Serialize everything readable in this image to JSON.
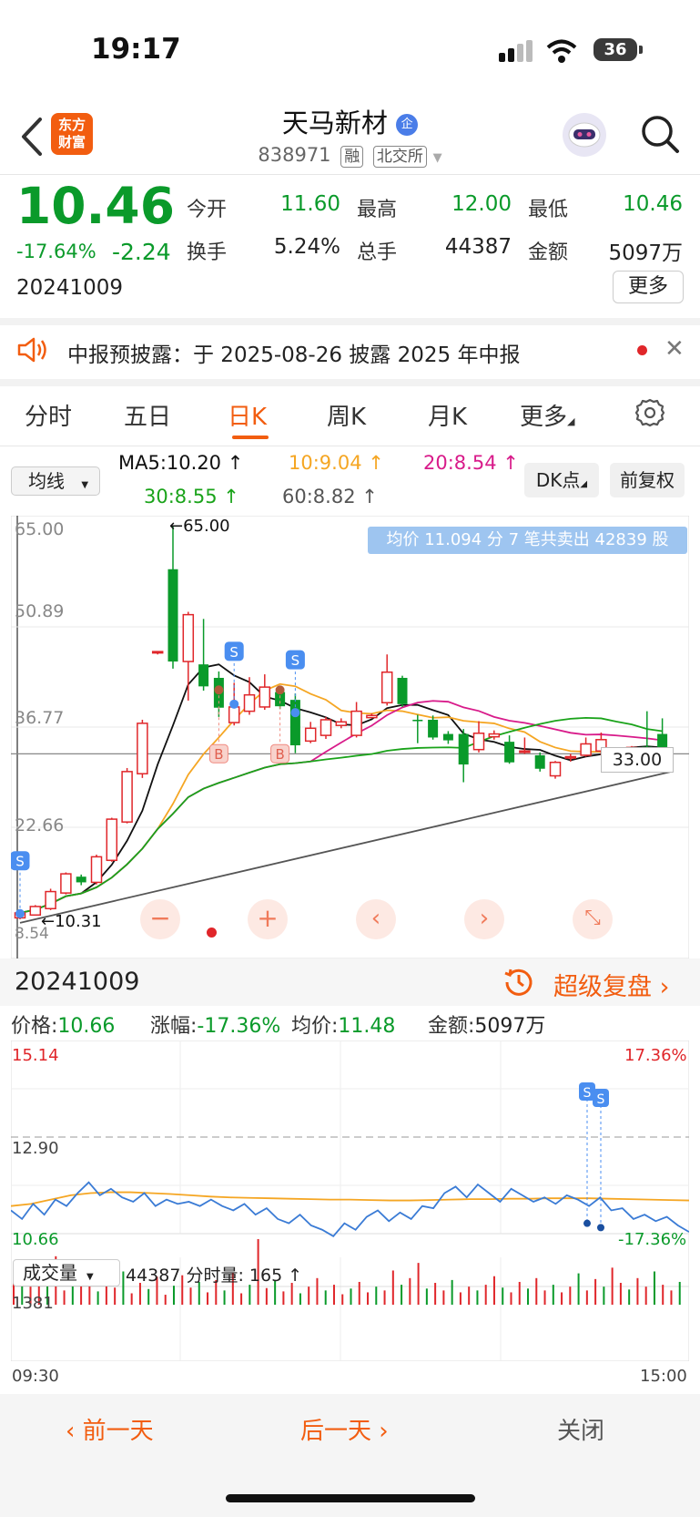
{
  "status": {
    "time": "19:17",
    "battery": "36"
  },
  "header": {
    "logo_line1": "东方",
    "logo_line2": "财富",
    "name": "天马新材",
    "badge": "企",
    "code": "838971",
    "tag1": "融",
    "tag2": "北交所"
  },
  "quote": {
    "price": "10.46",
    "pct": "-17.64%",
    "chg": "-2.24",
    "date": "20241009",
    "open_label": "今开",
    "open": "11.60",
    "high_label": "最高",
    "high": "12.00",
    "low_label": "最低",
    "low": "10.46",
    "turnover_label": "换手",
    "turnover": "5.24%",
    "volume_label": "总手",
    "volume": "44387",
    "amount_label": "金额",
    "amount": "5097万",
    "more": "更多"
  },
  "notice": {
    "text": "中报预披露：于 2025-08-26 披露 2025 年中报"
  },
  "tabs": [
    "分时",
    "五日",
    "日K",
    "周K",
    "月K",
    "更多"
  ],
  "ma": {
    "select": "均线",
    "ma5": "MA5:10.20 ↑",
    "ma10": "10:9.04 ↑",
    "ma20": "20:8.54 ↑",
    "ma30": "30:8.55 ↑",
    "ma60": "60:8.82 ↑",
    "dk": "DK点",
    "fq": "前复权",
    "colors": {
      "ma5": "#111111",
      "ma10": "#f5a623",
      "ma20": "#d81b8a",
      "ma30": "#1aa31a",
      "ma60": "#555555"
    }
  },
  "kchart": {
    "y_labels": [
      "65.00",
      "50.89",
      "36.77",
      "22.66",
      "8.54"
    ],
    "high_mark": "←65.00",
    "low_mark": "←10.31",
    "price_tag": "33.00",
    "banner": "均价 11.094 分 7 笔共卖出 42839 股",
    "buy": "B",
    "sell": "S"
  },
  "intraday": {
    "date": "20241009",
    "replay": "超级复盘",
    "price_label": "价格:",
    "price": "10.66",
    "chg_label": "涨幅:",
    "chg": "-17.36%",
    "avg_label": "均价:",
    "avg": "11.48",
    "amt_label": "金额:",
    "amt": "5097万",
    "y_top": "15.14",
    "y_mid": "12.90",
    "y_bot": "10.66",
    "pct_top": "17.36%",
    "pct_bot": "-17.36%",
    "vol_select": "成交量",
    "vol_info": "44387 分时量: 165 ↑",
    "vol_max": "1381",
    "t_start": "09:30",
    "t_end": "15:00"
  },
  "bottom": {
    "prev": "前一天",
    "next": "后一天",
    "close": "关闭"
  },
  "chart_data": {
    "type": "candlestick",
    "ylim": [
      8.54,
      65.0
    ],
    "candles": [
      [
        9.9,
        10.6,
        9.7,
        10.8
      ],
      [
        10.3,
        11.5,
        10.31,
        11.7
      ],
      [
        11.2,
        13.6,
        11.0,
        14.0
      ],
      [
        13.4,
        16.1,
        13.2,
        16.3
      ],
      [
        15.7,
        14.9,
        14.5,
        16.0
      ],
      [
        14.9,
        18.5,
        14.6,
        18.8
      ],
      [
        18.0,
        23.8,
        17.8,
        24.0
      ],
      [
        23.4,
        30.5,
        23.2,
        31.0
      ],
      [
        30.2,
        37.3,
        29.6,
        37.8
      ],
      [
        47.4,
        47.4,
        47.0,
        47.4
      ],
      [
        59.0,
        46.0,
        45.0,
        65.0
      ],
      [
        46.0,
        52.6,
        40.5,
        53.0
      ],
      [
        45.6,
        42.5,
        41.9,
        52.0
      ],
      [
        43.7,
        39.5,
        38.2,
        44.6
      ],
      [
        37.4,
        39.6,
        37.0,
        43.0
      ],
      [
        39.0,
        41.3,
        38.5,
        43.8
      ],
      [
        39.6,
        42.4,
        39.2,
        44.2
      ],
      [
        41.7,
        39.7,
        39.3,
        42.2
      ],
      [
        40.6,
        34.2,
        33.1,
        41.5
      ],
      [
        34.8,
        36.6,
        34.5,
        37.5
      ],
      [
        35.6,
        37.8,
        35.1,
        38.2
      ],
      [
        37.0,
        37.5,
        36.6,
        38.0
      ],
      [
        35.6,
        39.0,
        35.3,
        40.3
      ],
      [
        38.1,
        38.4,
        38.1,
        38.7
      ],
      [
        40.2,
        44.5,
        39.8,
        47.0
      ],
      [
        43.7,
        40.0,
        39.6,
        44.0
      ],
      [
        37.8,
        37.6,
        34.5,
        38.5
      ],
      [
        37.8,
        35.3,
        35.0,
        38.4
      ],
      [
        35.8,
        34.9,
        34.4,
        36.2
      ],
      [
        35.8,
        31.5,
        29.0,
        36.5
      ],
      [
        33.6,
        35.9,
        33.2,
        37.6
      ],
      [
        35.4,
        35.8,
        35.0,
        36.3
      ],
      [
        34.7,
        31.8,
        31.6,
        35.6
      ],
      [
        33.2,
        33.4,
        33.0,
        35.3
      ],
      [
        32.8,
        30.9,
        30.5,
        33.2
      ],
      [
        29.9,
        31.8,
        29.5,
        32.0
      ],
      [
        32.4,
        32.6,
        31.9,
        33.0
      ],
      [
        32.8,
        34.4,
        32.6,
        35.3
      ],
      [
        33.4,
        35.0,
        32.8,
        36.0
      ],
      [
        33.6,
        33.6,
        33.4,
        33.6
      ],
      [
        33.9,
        33.9,
        33.6,
        34.1
      ],
      [
        34.0,
        33.4,
        33.4,
        39.0
      ],
      [
        35.8,
        33.6,
        33.0,
        38.0
      ]
    ]
  }
}
